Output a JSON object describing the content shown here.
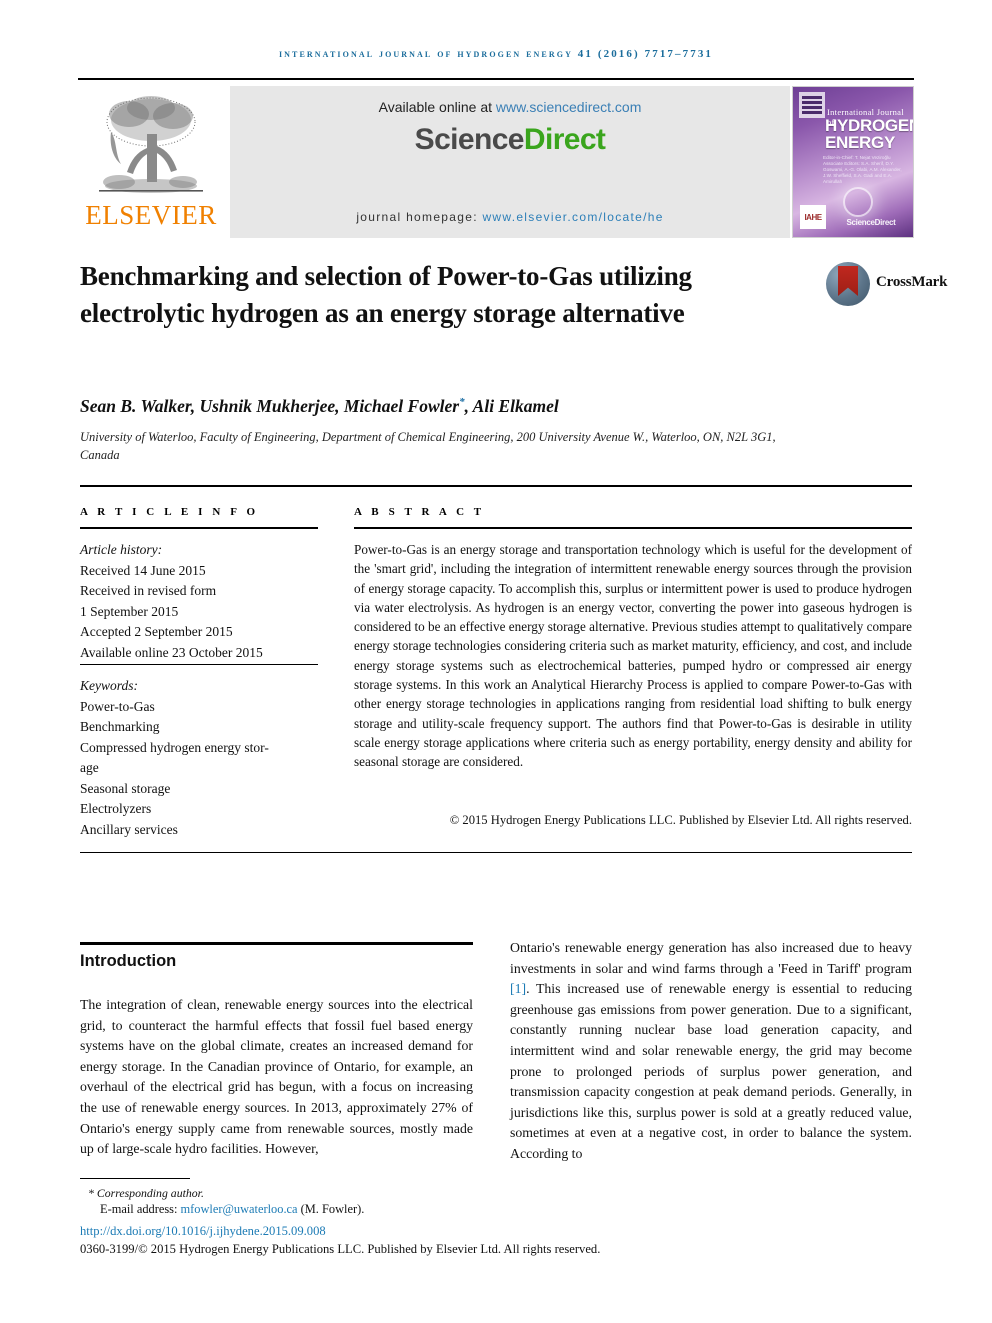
{
  "running_head": "International Journal of Hydrogen Energy 41 (2016) 7717–7731",
  "masthead": {
    "publisher_name": "ELSEVIER",
    "available_prefix": "Available online at ",
    "available_link": "www.sciencedirect.com",
    "sciencedirect_sci": "Science",
    "sciencedirect_direct": "Direct",
    "homepage_prefix": "journal homepage: ",
    "homepage_link": "www.elsevier.com/locate/he",
    "cover": {
      "line1": "International Journal of",
      "line2": "HYDROGEN",
      "line3": "ENERGY",
      "editors": "Editor-in-Chief: T. Nejat Veziroğlu\nAssociate Editors: S.A. Sherif, D.Y. Goswami, A.-G. Olabi,\nA.M. Alexander, J.W. Sheffield, S.A. Gadi and E.A. Amirullah",
      "institute_tag": "IAHE",
      "sd_note": "Available online at www.sciencedirect.com",
      "sd_tag": "ScienceDirect"
    }
  },
  "article": {
    "title": "Benchmarking and selection of Power-to-Gas utilizing electrolytic hydrogen as an energy storage alternative",
    "crossmark_label": "CrossMark",
    "authors": "Sean B. Walker, Ushnik Mukherjee, Michael Fowler",
    "authors_tail": ", Ali Elkamel",
    "corresponding_marker": "*",
    "affiliation": "University of Waterloo, Faculty of Engineering, Department of Chemical Engineering, 200 University Avenue W., Waterloo, ON, N2L 3G1, Canada"
  },
  "info": {
    "label": "A R T I C L E  I N F O",
    "history_heading": "Article history:",
    "history": [
      "Received 14 June 2015",
      "Received in revised form",
      "1 September 2015",
      "Accepted 2 September 2015",
      "Available online 23 October 2015"
    ],
    "keywords_heading": "Keywords:",
    "keywords": [
      "Power-to-Gas",
      "Benchmarking",
      "Compressed hydrogen energy stor-",
      "age",
      "Seasonal storage",
      "Electrolyzers",
      "Ancillary services"
    ]
  },
  "abstract": {
    "label": "A B S T R A C T",
    "text": "Power-to-Gas is an energy storage and transportation technology which is useful for the development of the 'smart grid', including the integration of intermittent renewable energy sources through the provision of energy storage capacity. To accomplish this, surplus or intermittent power is used to produce hydrogen via water electrolysis. As hydrogen is an energy vector, converting the power into gaseous hydrogen is considered to be an effective energy storage alternative. Previous studies attempt to qualitatively compare energy storage technologies considering criteria such as market maturity, efficiency, and cost, and include energy storage systems such as electrochemical batteries, pumped hydro or compressed air energy storage systems. In this work an Analytical Hierarchy Process is applied to compare Power-to-Gas with other energy storage technologies in applications ranging from residential load shifting to bulk energy storage and utility-scale frequency support. The authors find that Power-to-Gas is desirable in utility scale energy storage applications where criteria such as energy portability, energy density and ability for seasonal storage are considered.",
    "copyright": "© 2015 Hydrogen Energy Publications LLC. Published by Elsevier Ltd. All rights reserved."
  },
  "body": {
    "section_heading": "Introduction",
    "left_column": "The integration of clean, renewable energy sources into the electrical grid, to counteract the harmful effects that fossil fuel based energy systems have on the global climate, creates an increased demand for energy storage. In the Canadian province of Ontario, for example, an overhaul of the electrical grid has begun, with a focus on increasing the use of renewable energy sources. In 2013, approximately 27% of Ontario's energy supply came from renewable sources, mostly made up of large-scale hydro facilities. However,",
    "right_column_pre": "Ontario's renewable energy generation has also increased due to heavy investments in solar and wind farms through a 'Feed in Tariff' program ",
    "right_column_ref": "[1]",
    "right_column_post": ". This increased use of renewable energy is essential to reducing greenhouse gas emissions from power generation. Due to a significant, constantly running nuclear base load generation capacity, and intermittent wind and solar renewable energy, the grid may become prone to prolonged periods of surplus power generation, and transmission capacity congestion at peak demand periods. Generally, in jurisdictions like this, surplus power is sold at a greatly reduced value, sometimes at even at a negative cost, in order to balance the system. According to"
  },
  "footer": {
    "corresponding_note": "* Corresponding author.",
    "email_label": "E-mail address: ",
    "email": "mfowler@uwaterloo.ca",
    "email_owner": " (M. Fowler).",
    "doi": "http://dx.doi.org/10.1016/j.ijhydene.2015.09.008",
    "issn_line": "0360-3199/© 2015 Hydrogen Energy Publications LLC. Published by Elsevier Ltd. All rights reserved."
  },
  "colors": {
    "link": "#1c7bb5",
    "running_head": "#1b6d9c",
    "elsevier_orange": "#f08000",
    "sciencedirect_green": "#3aa51d"
  }
}
